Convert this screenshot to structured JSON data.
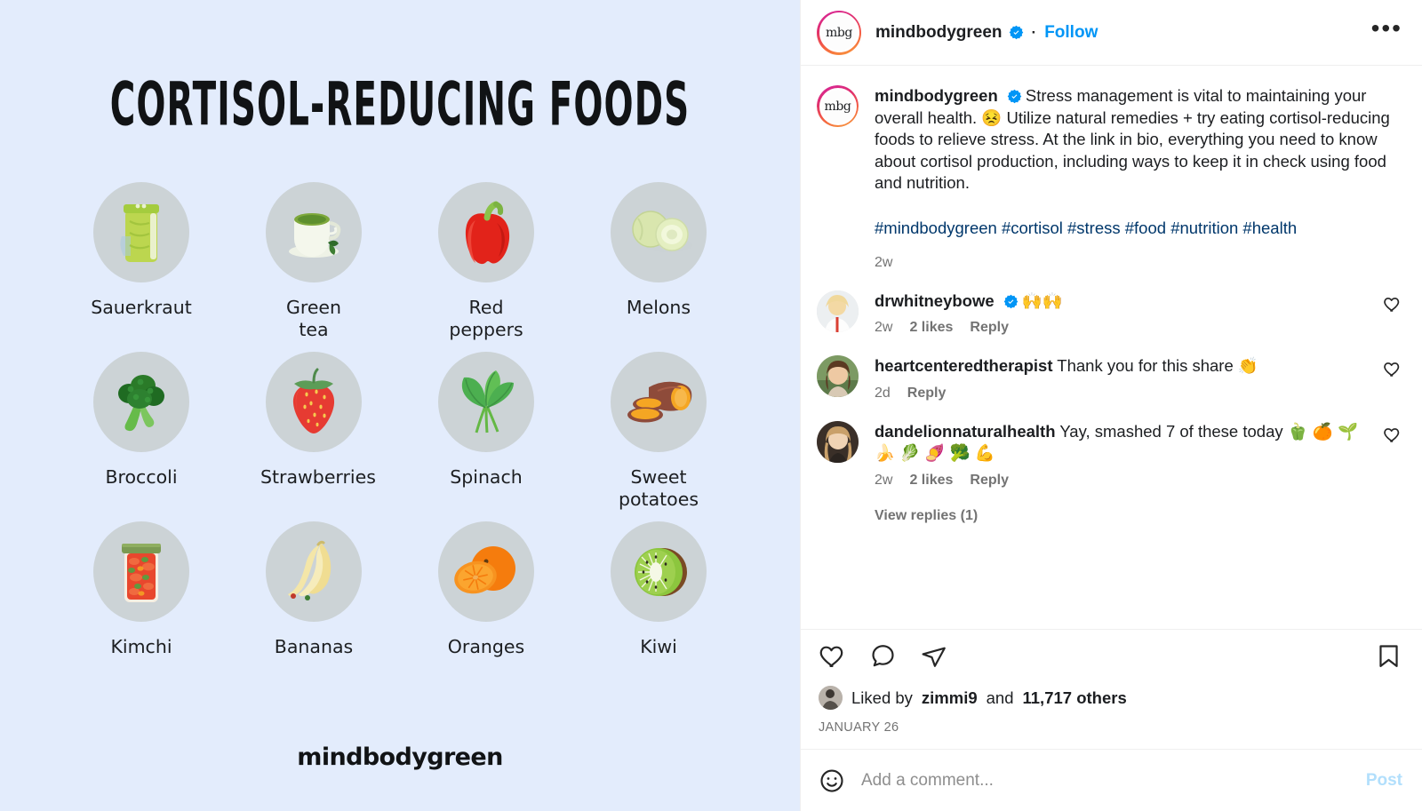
{
  "post_image": {
    "title": "CORTISOL-REDUCING FOODS",
    "background_color": "#e3ecfc",
    "bubble_color": "#ccd3d6",
    "brand_logo": "mindbodygreen",
    "foods": [
      {
        "label": "Sauerkraut",
        "icon": "sauerkraut-jar-icon"
      },
      {
        "label": "Green\ntea",
        "icon": "green-tea-cup-icon"
      },
      {
        "label": "Red\npeppers",
        "icon": "red-bell-pepper-icon"
      },
      {
        "label": "Melons",
        "icon": "melon-icon"
      },
      {
        "label": "Broccoli",
        "icon": "broccoli-icon"
      },
      {
        "label": "Strawberries",
        "icon": "strawberry-icon"
      },
      {
        "label": "Spinach",
        "icon": "spinach-leaves-icon"
      },
      {
        "label": "Sweet\npotatoes",
        "icon": "sweet-potato-icon"
      },
      {
        "label": "Kimchi",
        "icon": "kimchi-jar-icon"
      },
      {
        "label": "Bananas",
        "icon": "banana-icon"
      },
      {
        "label": "Oranges",
        "icon": "orange-icon"
      },
      {
        "label": "Kiwi",
        "icon": "kiwi-icon"
      }
    ]
  },
  "header": {
    "username": "mindbodygreen",
    "avatar_text": "mbg",
    "separator": "·",
    "follow_label": "Follow",
    "more_label": "•••",
    "verified": true
  },
  "caption": {
    "username": "mindbodygreen",
    "text": "Stress management is vital to maintaining your overall health. 😣 Utilize natural remedies + try eating cortisol-reducing foods to relieve stress. At the link in bio, everything you need to know about cortisol production, including ways to keep it in check using food and nutrition.",
    "hashtags": "#mindbodygreen #cortisol #stress #food #nutrition #health",
    "time": "2w"
  },
  "comments": [
    {
      "username": "drwhitneybowe",
      "verified": true,
      "text": "🙌🙌",
      "time": "2w",
      "likes": "2 likes",
      "reply_label": "Reply",
      "view_replies": null
    },
    {
      "username": "heartcenteredtherapist",
      "verified": false,
      "text": "Thank you for this share 👏",
      "time": "2d",
      "likes": null,
      "reply_label": "Reply",
      "view_replies": null
    },
    {
      "username": "dandelionnaturalhealth",
      "verified": false,
      "text": "Yay, smashed 7 of these today 🫑 🍊 🌱 🍌 🥬 🍠 🥦 💪",
      "time": "2w",
      "likes": "2 likes",
      "reply_label": "Reply",
      "view_replies": "View replies (1)"
    }
  ],
  "actions": {
    "like": "like-icon",
    "comment": "comment-icon",
    "share": "share-icon",
    "save": "save-icon"
  },
  "likes_summary": {
    "prefix": "Liked by ",
    "username": "zimmi9",
    "middle": " and ",
    "count": "11,717 others"
  },
  "post_date": "JANUARY 26",
  "add_comment": {
    "placeholder": "Add a comment...",
    "value": "",
    "post_label": "Post",
    "emoji_icon": "emoji-smiley-icon"
  },
  "colors": {
    "instagram_blue": "#0095f6",
    "hashtag_blue": "#00376b",
    "muted_gray": "#737373",
    "text_dark": "#1c1e21"
  }
}
